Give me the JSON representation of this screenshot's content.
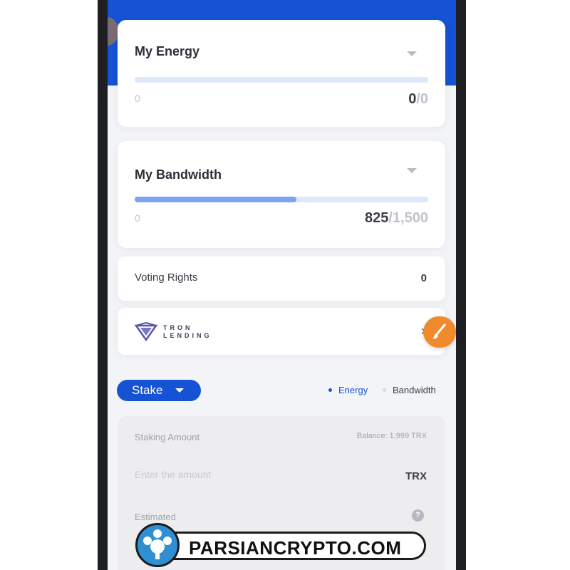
{
  "energy": {
    "title": "My Energy",
    "min_label": "0",
    "used": "0",
    "total": "/0",
    "fill_fraction": 0
  },
  "bandwidth": {
    "title": "My Bandwidth",
    "min_label": "0",
    "used": "825",
    "total": "/1,500",
    "fill_fraction": 0.55
  },
  "voting": {
    "label": "Voting Rights",
    "value": "0"
  },
  "tron_lending": {
    "logo_line1": "TRON",
    "logo_line2": "LENDING",
    "chevron": "›"
  },
  "stake": {
    "mode_label": "Stake",
    "options": [
      "Energy",
      "Bandwidth"
    ],
    "selected_option": "Energy",
    "staking_amount_label": "Staking Amount",
    "balance": "Balance: 1,999 TRX",
    "amount_placeholder": "Enter the amount",
    "unit": "TRX",
    "estimated_label": "Estimated",
    "help_glyph": "?"
  },
  "watermark": {
    "text": "PARSIANCRYPTO.COM"
  },
  "colors": {
    "primary_blue": "#1552d4",
    "bar_fill": "#7ea3f0",
    "bar_track": "#dfe7fa",
    "accent_orange": "#f08a2c"
  },
  "icons": {
    "energy_caret": "caret-down-icon",
    "bandwidth_caret": "caret-down-icon",
    "tron_logo": "tron-lending-logo",
    "chevron": "chevron-right-icon",
    "fab": "brush-icon",
    "help": "help-circle-icon"
  }
}
